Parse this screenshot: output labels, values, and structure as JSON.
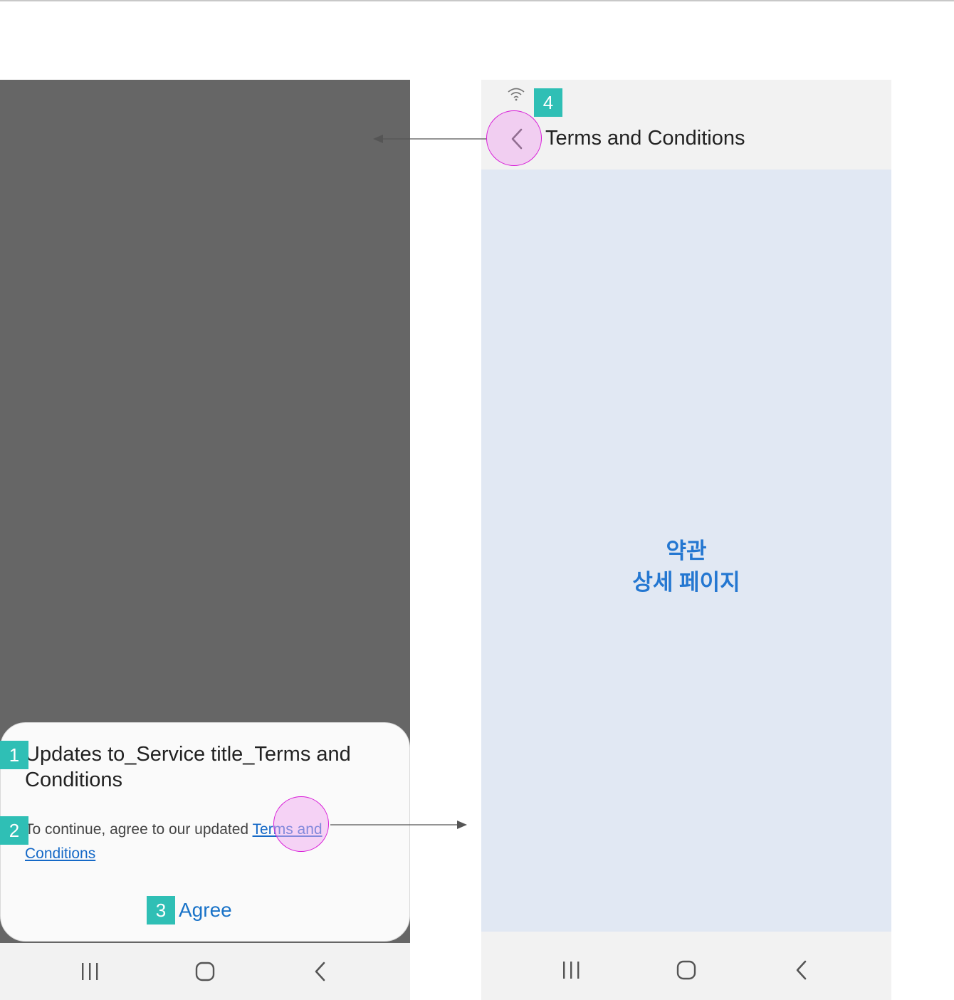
{
  "dialog": {
    "title": "Updates to_Service title_Terms and Conditions",
    "body_prefix": "To continue, agree to our updated ",
    "body_link": "Terms and Conditions",
    "agree_label": "Agree"
  },
  "terms_screen": {
    "title": "Terms and Conditions",
    "placeholder_line1": "약관",
    "placeholder_line2": "상세 페이지"
  },
  "annotations": {
    "badges": [
      "1",
      "2",
      "3",
      "4"
    ]
  },
  "icons": {
    "nav": [
      "recents-icon",
      "home-icon",
      "back-icon"
    ],
    "status": [
      "wifi-icon"
    ],
    "appbar": [
      "back-arrow-icon"
    ]
  },
  "colors": {
    "scrim": "#666666",
    "link": "#1569c7",
    "accent": "#1a73c8",
    "badge": "#2fbfb5",
    "touch_ring": "#d81bd8",
    "content_bg": "#e1e8f3"
  }
}
